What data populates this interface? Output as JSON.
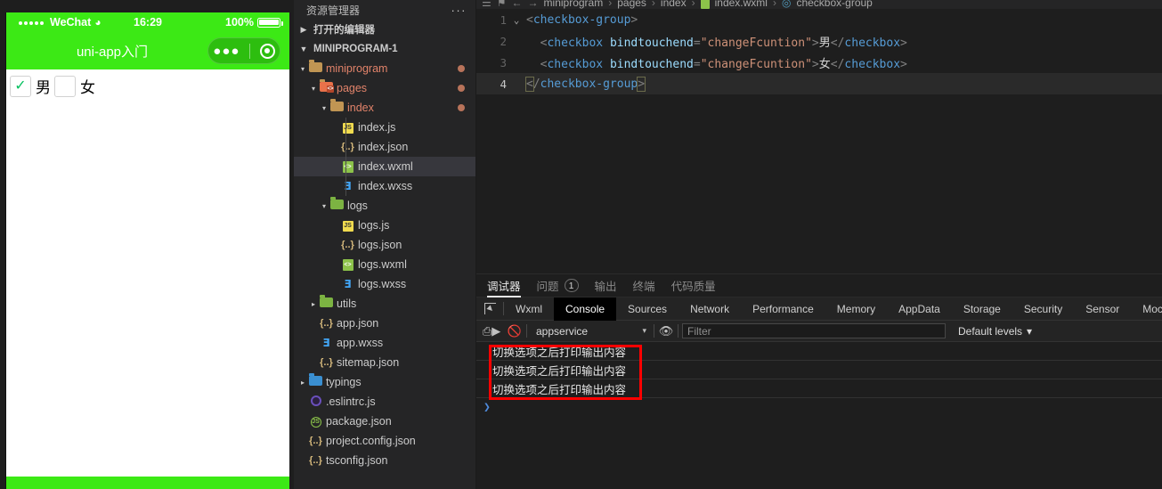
{
  "simulator": {
    "status_bar": {
      "carrier": "WeChat",
      "wifi_icon": "wifi-icon",
      "time": "16:29",
      "battery_pct": "100%"
    },
    "nav": {
      "title": "uni-app入门",
      "capsule_more_icon": "more-dots-icon",
      "capsule_target_icon": "target-circle-icon"
    },
    "checkbox_group": [
      {
        "label": "男",
        "checked": true,
        "check_glyph": "✓"
      },
      {
        "label": "女",
        "checked": false,
        "check_glyph": ""
      }
    ]
  },
  "explorer": {
    "header_title": "资源管理器",
    "header_more": "···",
    "open_editors": "打开的编辑器",
    "project_name": "MINIPROGRAM-1",
    "tree": [
      {
        "name": "miniprogram",
        "kind": "folder",
        "indent": 1,
        "twisty": "▾",
        "modified": true,
        "dot": true
      },
      {
        "name": "pages",
        "kind": "folder-pages",
        "indent": 2,
        "twisty": "▾",
        "modified": true,
        "dot": true
      },
      {
        "name": "index",
        "kind": "folder",
        "indent": 3,
        "twisty": "▾",
        "modified": true,
        "dot": true
      },
      {
        "name": "index.js",
        "kind": "js",
        "indent": 4,
        "twisty": "",
        "modified": false,
        "dot": false
      },
      {
        "name": "index.json",
        "kind": "json",
        "indent": 4,
        "twisty": "",
        "modified": false,
        "dot": false
      },
      {
        "name": "index.wxml",
        "kind": "wxml",
        "indent": 4,
        "twisty": "",
        "modified": false,
        "dot": false,
        "selected": true
      },
      {
        "name": "index.wxss",
        "kind": "wxss",
        "indent": 4,
        "twisty": "",
        "modified": false,
        "dot": false
      },
      {
        "name": "logs",
        "kind": "folder-g",
        "indent": 3,
        "twisty": "▾",
        "modified": false,
        "dot": false
      },
      {
        "name": "logs.js",
        "kind": "js",
        "indent": 4,
        "twisty": "",
        "modified": false,
        "dot": false
      },
      {
        "name": "logs.json",
        "kind": "json",
        "indent": 4,
        "twisty": "",
        "modified": false,
        "dot": false
      },
      {
        "name": "logs.wxml",
        "kind": "wxml",
        "indent": 4,
        "twisty": "",
        "modified": false,
        "dot": false
      },
      {
        "name": "logs.wxss",
        "kind": "wxss",
        "indent": 4,
        "twisty": "",
        "modified": false,
        "dot": false
      },
      {
        "name": "utils",
        "kind": "folder-g",
        "indent": 2,
        "twisty": "▸",
        "modified": false,
        "dot": false
      },
      {
        "name": "app.json",
        "kind": "json",
        "indent": 2,
        "twisty": "",
        "modified": false,
        "dot": false
      },
      {
        "name": "app.wxss",
        "kind": "wxss",
        "indent": 2,
        "twisty": "",
        "modified": false,
        "dot": false
      },
      {
        "name": "sitemap.json",
        "kind": "json",
        "indent": 2,
        "twisty": "",
        "modified": false,
        "dot": false
      },
      {
        "name": "typings",
        "kind": "folder-b",
        "indent": 1,
        "twisty": "▸",
        "modified": false,
        "dot": false
      },
      {
        "name": ".eslintrc.js",
        "kind": "eslint",
        "indent": 1,
        "twisty": "",
        "modified": false,
        "dot": false
      },
      {
        "name": "package.json",
        "kind": "pkg",
        "indent": 1,
        "twisty": "",
        "modified": false,
        "dot": false
      },
      {
        "name": "project.config.json",
        "kind": "json",
        "indent": 1,
        "twisty": "",
        "modified": false,
        "dot": false
      },
      {
        "name": "tsconfig.json",
        "kind": "json",
        "indent": 1,
        "twisty": "",
        "modified": false,
        "dot": false
      }
    ]
  },
  "breadcrumb": {
    "menu_icon": "hamburger-icon",
    "bookmark_icon": "bookmark-icon",
    "back_icon": "arrow-left-icon",
    "forward_icon": "arrow-right-icon",
    "parts": [
      "miniprogram",
      "pages",
      "index",
      "index.wxml",
      "checkbox-group"
    ],
    "separator": "›"
  },
  "editor": {
    "lines": [
      {
        "no": "1",
        "fold": "⌄",
        "active": false,
        "tokens": [
          {
            "t": "punct",
            "v": "<"
          },
          {
            "t": "tag",
            "v": "checkbox-group"
          },
          {
            "t": "punct",
            "v": ">"
          }
        ]
      },
      {
        "no": "2",
        "fold": "",
        "active": false,
        "tokens": [
          {
            "t": "punct",
            "v": "  <"
          },
          {
            "t": "tag",
            "v": "checkbox"
          },
          {
            "t": "txt",
            "v": " "
          },
          {
            "t": "attr",
            "v": "bindtouchend"
          },
          {
            "t": "punct",
            "v": "="
          },
          {
            "t": "str",
            "v": "\"changeFcuntion\""
          },
          {
            "t": "punct",
            "v": ">"
          },
          {
            "t": "txt",
            "v": "男"
          },
          {
            "t": "punct",
            "v": "</"
          },
          {
            "t": "tag",
            "v": "checkbox"
          },
          {
            "t": "punct",
            "v": ">"
          }
        ]
      },
      {
        "no": "3",
        "fold": "",
        "active": false,
        "tokens": [
          {
            "t": "punct",
            "v": "  <"
          },
          {
            "t": "tag",
            "v": "checkbox"
          },
          {
            "t": "txt",
            "v": " "
          },
          {
            "t": "attr",
            "v": "bindtouchend"
          },
          {
            "t": "punct",
            "v": "="
          },
          {
            "t": "str",
            "v": "\"changeFcuntion\""
          },
          {
            "t": "punct",
            "v": ">"
          },
          {
            "t": "txt",
            "v": "女"
          },
          {
            "t": "punct",
            "v": "</"
          },
          {
            "t": "tag",
            "v": "checkbox"
          },
          {
            "t": "punct",
            "v": ">"
          }
        ]
      },
      {
        "no": "4",
        "fold": "",
        "active": true,
        "tokens": [
          {
            "t": "punct brk",
            "v": "<"
          },
          {
            "t": "punct",
            "v": "/"
          },
          {
            "t": "tag",
            "v": "checkbox-group"
          },
          {
            "t": "punct brk",
            "v": ">"
          }
        ]
      }
    ]
  },
  "panel": {
    "tabs": [
      {
        "label": "调试器",
        "active": true,
        "badge": ""
      },
      {
        "label": "问题",
        "active": false,
        "badge": "1"
      },
      {
        "label": "输出",
        "active": false,
        "badge": ""
      },
      {
        "label": "终端",
        "active": false,
        "badge": ""
      },
      {
        "label": "代码质量",
        "active": false,
        "badge": ""
      }
    ],
    "devtools_tabs": [
      {
        "label": "Wxml",
        "active": false
      },
      {
        "label": "Console",
        "active": true
      },
      {
        "label": "Sources",
        "active": false
      },
      {
        "label": "Network",
        "active": false
      },
      {
        "label": "Performance",
        "active": false
      },
      {
        "label": "Memory",
        "active": false
      },
      {
        "label": "AppData",
        "active": false
      },
      {
        "label": "Storage",
        "active": false
      },
      {
        "label": "Security",
        "active": false
      },
      {
        "label": "Sensor",
        "active": false
      },
      {
        "label": "Mock",
        "active": false
      }
    ],
    "inspect_icon": "inspect-cursor-icon",
    "console_toolbar": {
      "sidebar_icon": "console-sidebar-icon",
      "clear_icon": "clear-console-icon",
      "context_value": "appservice",
      "context_caret": "▾",
      "eye_icon": "live-expression-eye-icon",
      "filter_placeholder": "Filter",
      "filter_value": "",
      "levels_label": "Default levels",
      "levels_caret": "▾"
    },
    "console_output": [
      "切换选项之后打印输出内容",
      "切换选项之后打印输出内容",
      "切换选项之后打印输出内容"
    ],
    "prompt_glyph": "❯",
    "annotation_color": "#ff0000"
  }
}
